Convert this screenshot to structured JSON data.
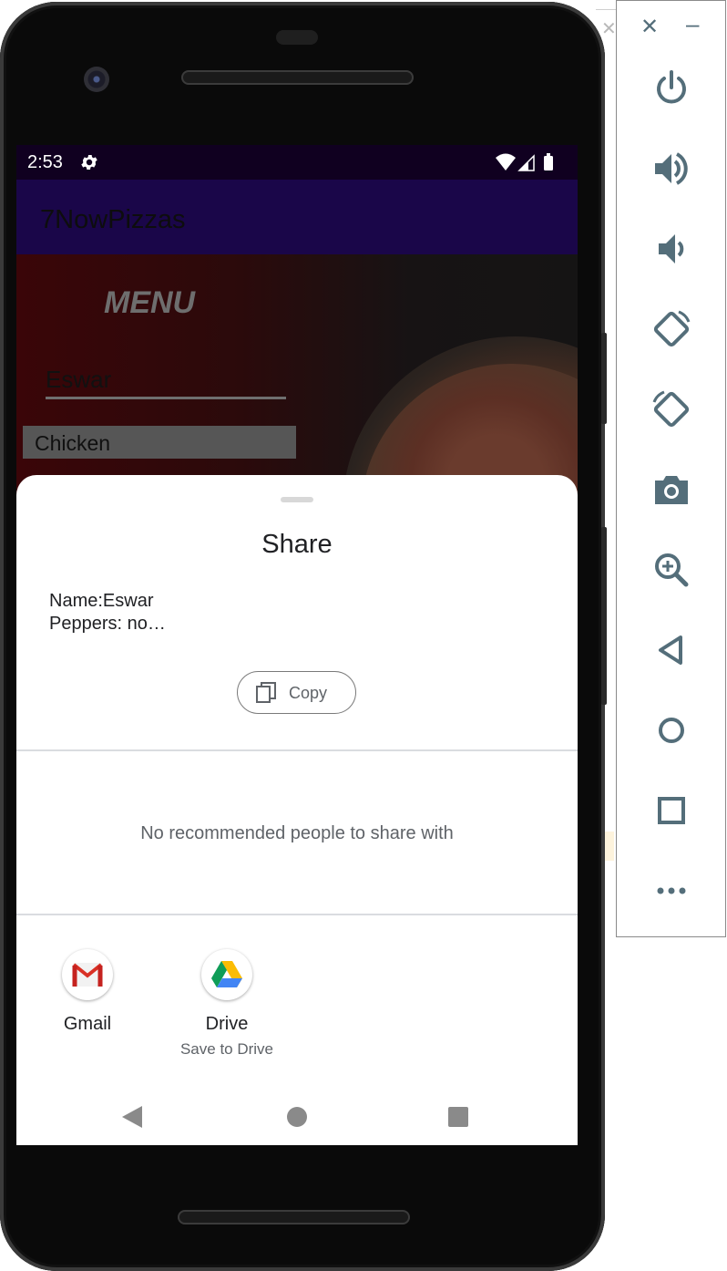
{
  "status_bar": {
    "time": "2:53"
  },
  "app": {
    "title": "7NowPizzas"
  },
  "menu": {
    "heading": "MENU",
    "name_value": "Eswar",
    "spinner_value": "Chicken"
  },
  "share_sheet": {
    "title": "Share",
    "text_line1": "Name:Eswar",
    "text_line2": "Peppers: no…",
    "copy_label": "Copy",
    "no_people_text": "No recommended people to share with",
    "targets": [
      {
        "label": "Gmail",
        "sublabel": "",
        "icon": "gmail-icon"
      },
      {
        "label": "Drive",
        "sublabel": "Save to Drive",
        "icon": "drive-icon"
      }
    ]
  },
  "emulator_toolbar": {
    "buttons": [
      "close",
      "minimize",
      "power",
      "volume-up",
      "volume-down",
      "rotate-left",
      "rotate-right",
      "screenshot",
      "zoom",
      "back",
      "home",
      "overview",
      "more"
    ]
  },
  "colors": {
    "status_bar": "#100020",
    "app_bar": "#1a0649",
    "toolbar_icon": "#546e7a",
    "sheet_bg": "#ffffff"
  }
}
